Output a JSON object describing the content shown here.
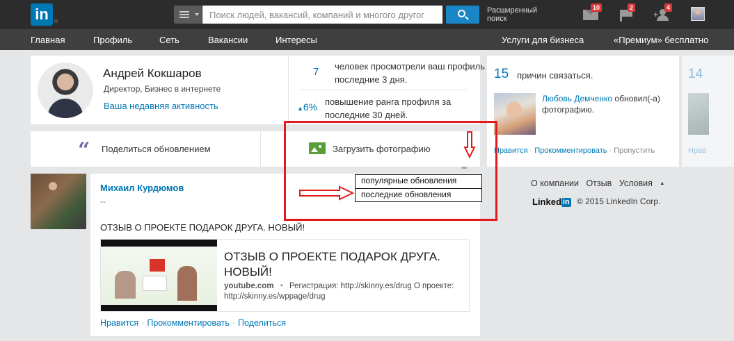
{
  "header": {
    "logo_text": "in",
    "search_placeholder": "Поиск людей, вакансий, компаний и многого другог",
    "advanced_search": "Расширенный поиск",
    "badges": {
      "messages": "10",
      "notifications": "2",
      "connections": "4"
    }
  },
  "nav": {
    "items": [
      "Главная",
      "Профиль",
      "Сеть",
      "Вакансии",
      "Интересы"
    ],
    "right": [
      "Услуги для бизнеса",
      "«Премиум» бесплатно"
    ]
  },
  "profile": {
    "name": "Андрей Кокшаров",
    "title": "Директор, Бизнес в интернете",
    "activity_link": "Ваша недавняя активность",
    "stats": [
      {
        "num": "7",
        "text": "человек просмотрели ваш профиль за последние 3 дня."
      },
      {
        "num": "6%",
        "text": "повышение ранга профиля за последние 30 дней."
      }
    ]
  },
  "share": {
    "share_label": "Поделиться обновлением",
    "upload_label": "Загрузить фотографию",
    "more_dots": "•••"
  },
  "sort_menu": {
    "options": [
      "популярные обновления",
      "последние обновления"
    ]
  },
  "post": {
    "author": "Михаил Курдюмов",
    "subline": "--",
    "text": "ОТЗЫВ О ПРОЕКТЕ ПОДАРОК ДРУГА. НОВЫЙ!",
    "preview_title": "ОТЗЫВ О ПРОЕКТЕ ПОДАРОК ДРУГА. НОВЫЙ!",
    "preview_source": "youtube.com",
    "preview_desc": "Регистрация: http://skinny.es/drug О проекте: http://skinny.es/wppage/drug",
    "actions": [
      "Нравится",
      "Прокомментировать",
      "Поделиться"
    ]
  },
  "right_card": {
    "count": "15",
    "label": "причин связаться.",
    "update_who": "Любовь Демченко",
    "update_text": "обновил(-а) фотографию.",
    "actions": [
      "Нравится",
      "Прокомментировать",
      "Пропустить"
    ]
  },
  "right_card2": {
    "count": "14",
    "action": "Нрав"
  },
  "footer": {
    "links": [
      "О компании",
      "Отзыв",
      "Условия"
    ],
    "logo_text": "Linked",
    "logo_in": "in",
    "copyright": "© 2015 LinkedIn Corp."
  }
}
